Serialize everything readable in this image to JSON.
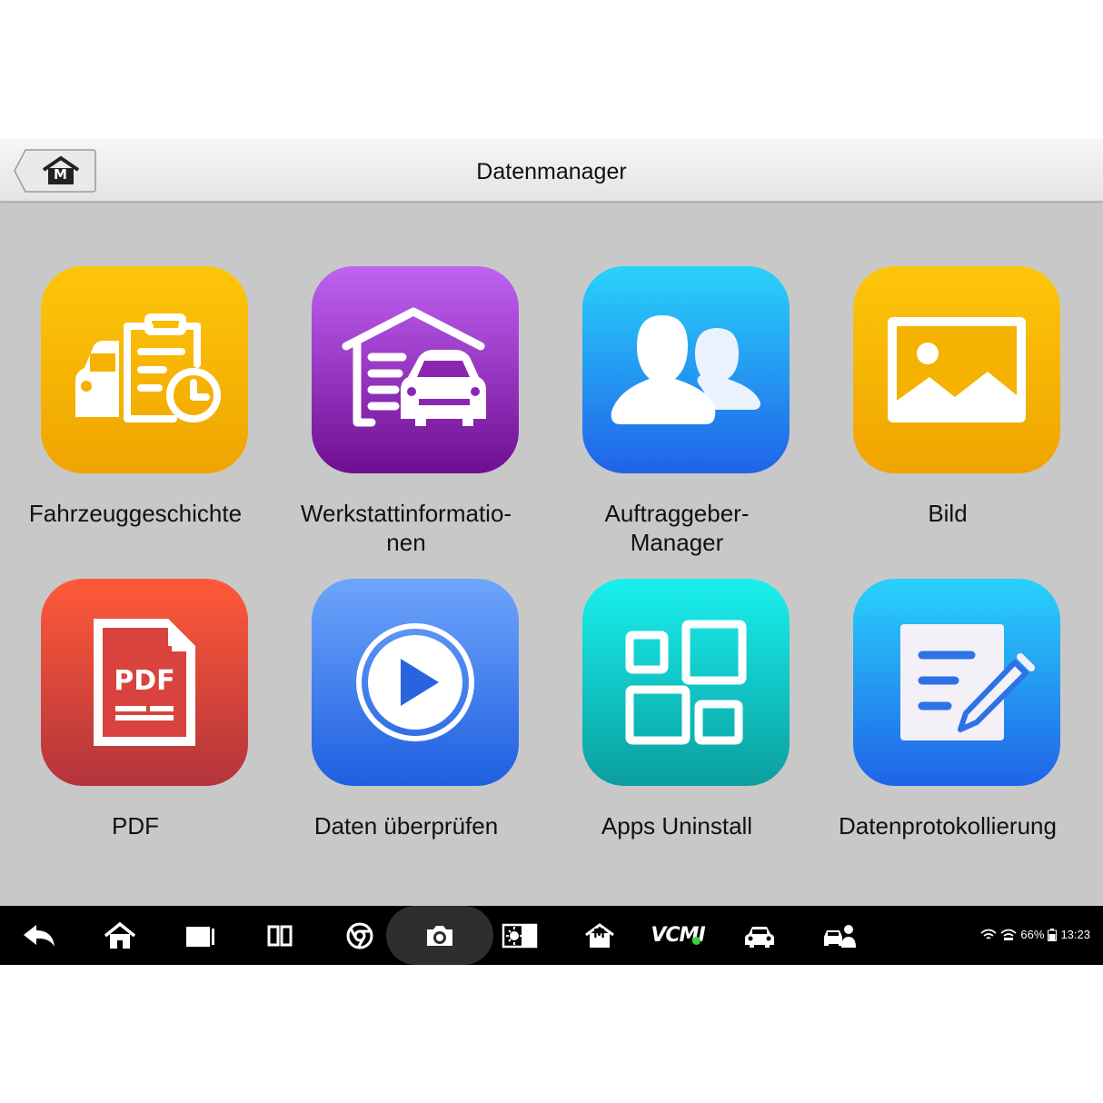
{
  "header": {
    "title": "Datenmanager",
    "home_letter": "M"
  },
  "tiles": [
    {
      "label": "Fahrzeuggeschichte",
      "icon": "vehicle-history-icon",
      "colors": [
        "#fdc60a",
        "#f0a400"
      ]
    },
    {
      "label": "Werkstattinformatio-\nnen",
      "icon": "workshop-garage-icon",
      "colors": [
        "#c062f2",
        "#6e0f92"
      ]
    },
    {
      "label": "Auftraggeber-\nManager",
      "icon": "customers-icon",
      "colors": [
        "#29d2fb",
        "#2063e8"
      ]
    },
    {
      "label": "Bild",
      "icon": "image-icon",
      "colors": [
        "#fdc60a",
        "#f0a400"
      ]
    },
    {
      "label": "PDF",
      "icon": "pdf-file-icon",
      "colors": [
        "#ff5a38",
        "#b3343c"
      ]
    },
    {
      "label": "Daten überprüfen",
      "icon": "play-video-icon",
      "colors": [
        "#6ea5fb",
        "#1f5fe0"
      ]
    },
    {
      "label": "Apps Uninstall",
      "icon": "apps-grid-icon",
      "colors": [
        "#19f0ee",
        "#0b9e9e"
      ]
    },
    {
      "label": "Datenprotokollierung",
      "icon": "data-log-edit-icon",
      "colors": [
        "#29d2fb",
        "#2063e8"
      ]
    }
  ],
  "navbar": {
    "vcm_label": "VCMI",
    "home_letter": "M",
    "battery": "66%",
    "time": "13:23"
  }
}
